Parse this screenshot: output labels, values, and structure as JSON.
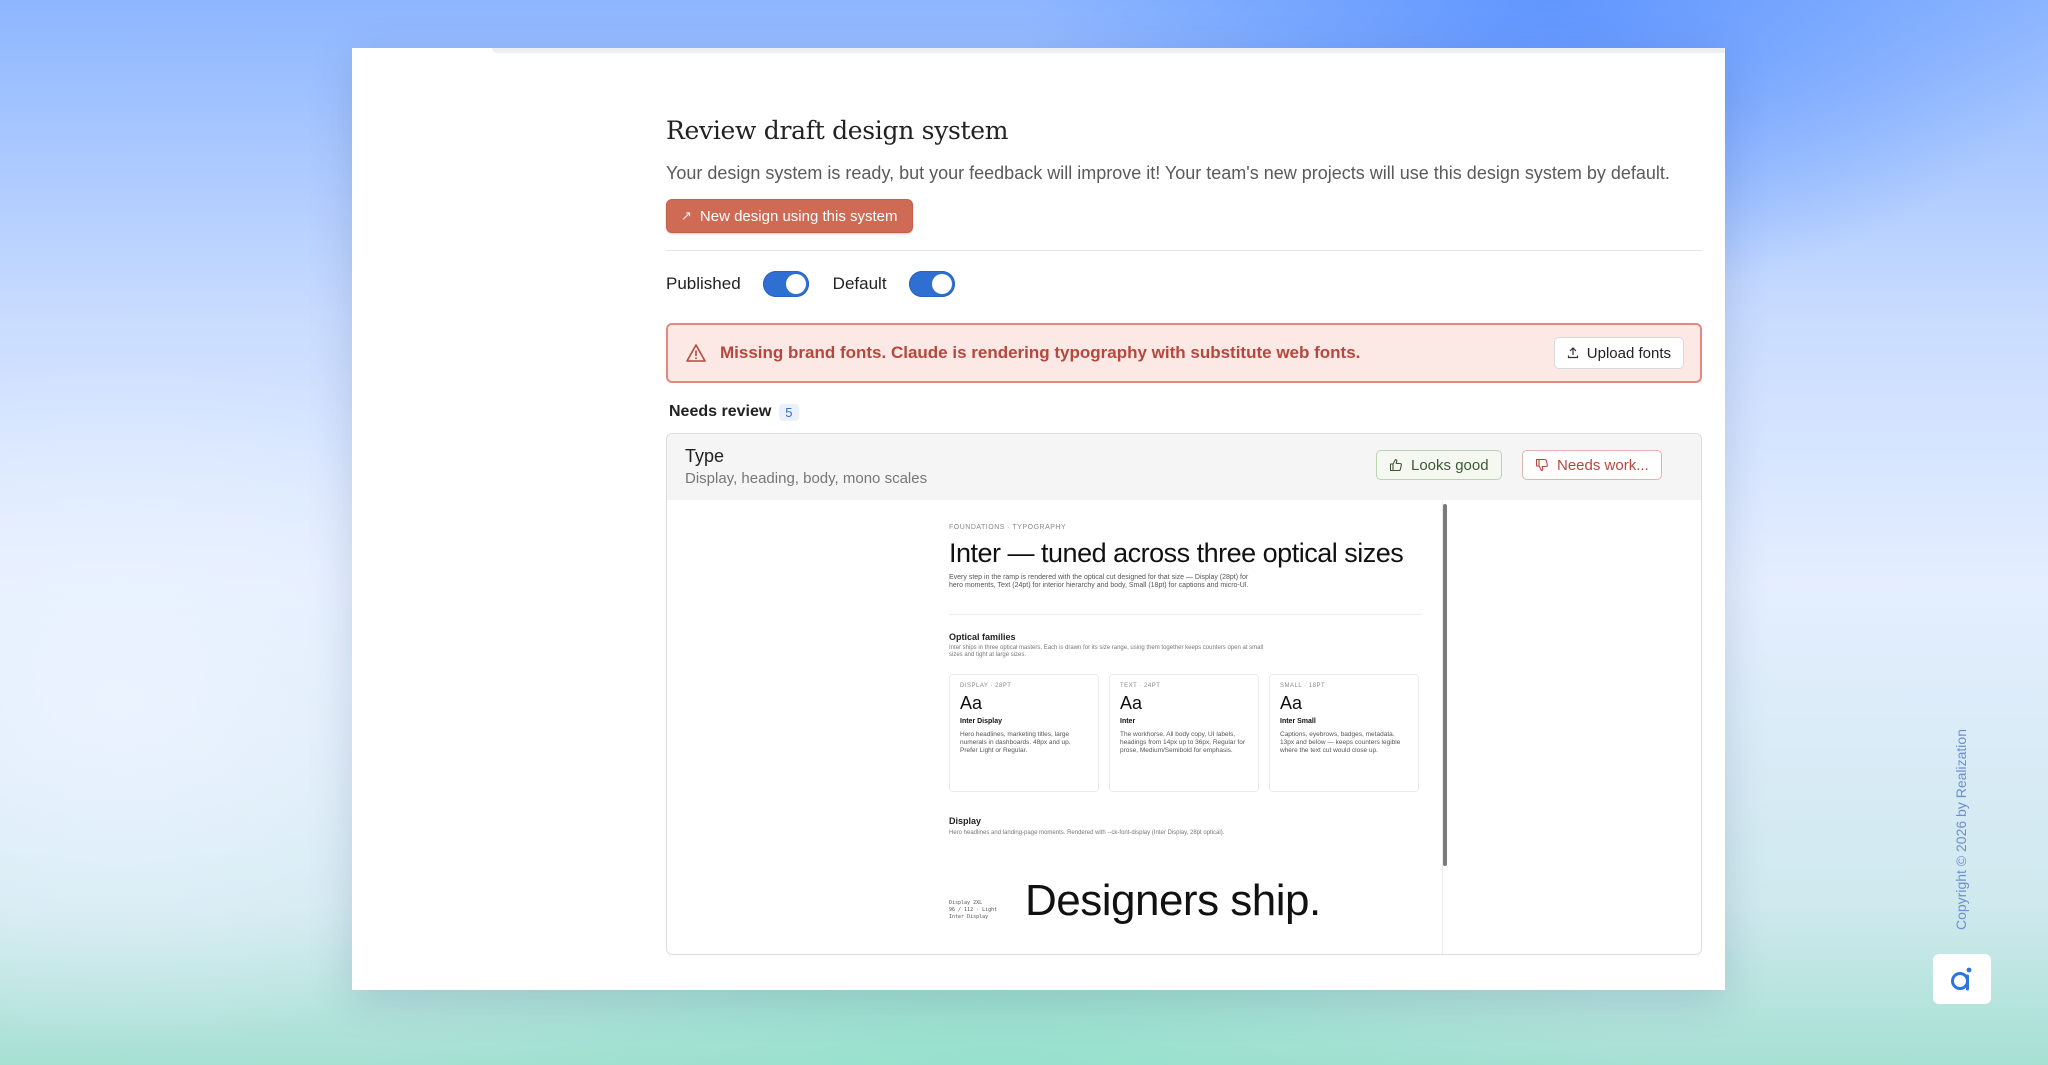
{
  "page": {
    "title": "Review draft design system",
    "description": "Your design system is ready, but your feedback will improve it! Your team's new projects will use this design system by default.",
    "new_design_button": "New design using this system"
  },
  "toggles": {
    "published_label": "Published",
    "published_on": true,
    "default_label": "Default",
    "default_on": true
  },
  "alert": {
    "message": "Missing brand fonts. Claude is rendering typography with substitute web fonts.",
    "upload_button": "Upload fonts"
  },
  "review": {
    "label": "Needs review",
    "count": "5"
  },
  "card": {
    "title": "Type",
    "subtitle": "Display, heading, body, mono scales",
    "looks_good": "Looks good",
    "needs_work": "Needs work..."
  },
  "preview": {
    "eyebrow": "FOUNDATIONS · TYPOGRAPHY",
    "heading": "Inter — tuned across three optical sizes",
    "intro": "Every step in the ramp is rendered with the optical cut designed for that size — Display (28pt) for hero moments, Text (24pt) for interior hierarchy and body, Small (18pt) for captions and micro-UI.",
    "families_title": "Optical families",
    "families_desc": "Inter ships in three optical masters. Each is drawn for its size range, using them together keeps counters open at small sizes and tight at large sizes.",
    "families": [
      {
        "label": "DISPLAY · 28PT",
        "sample": "Aa",
        "name": "Inter Display",
        "desc": "Hero headlines, marketing titles, large numerals in dashboards. 48px and up. Prefer Light or Regular."
      },
      {
        "label": "TEXT · 24PT",
        "sample": "Aa",
        "name": "Inter",
        "desc": "The workhorse. All body copy, UI labels, headings from 14px up to 36px. Regular for prose, Medium/Semibold for emphasis."
      },
      {
        "label": "SMALL · 18PT",
        "sample": "Aa",
        "name": "Inter Small",
        "desc": "Captions, eyebrows, badges, metadata. 13px and below — keeps counters legible where the text cut would close up."
      }
    ],
    "display_title": "Display",
    "display_desc": "Hero headlines and landing-page moments. Rendered with --ck-font-display (Inter Display, 28pt optical).",
    "display_meta_1": "Display 2XL",
    "display_meta_2": "96 / 112 · Light",
    "display_meta_3": "Inter Display",
    "display_sample": "Designers ship."
  },
  "footer": {
    "copyright": "Copyright © 2026 by Realization"
  },
  "colors": {
    "accent": "#2f6fd1",
    "primary_button": "#cf6a55",
    "alert_bg": "#fce9e5",
    "alert_text": "#b5483d"
  }
}
